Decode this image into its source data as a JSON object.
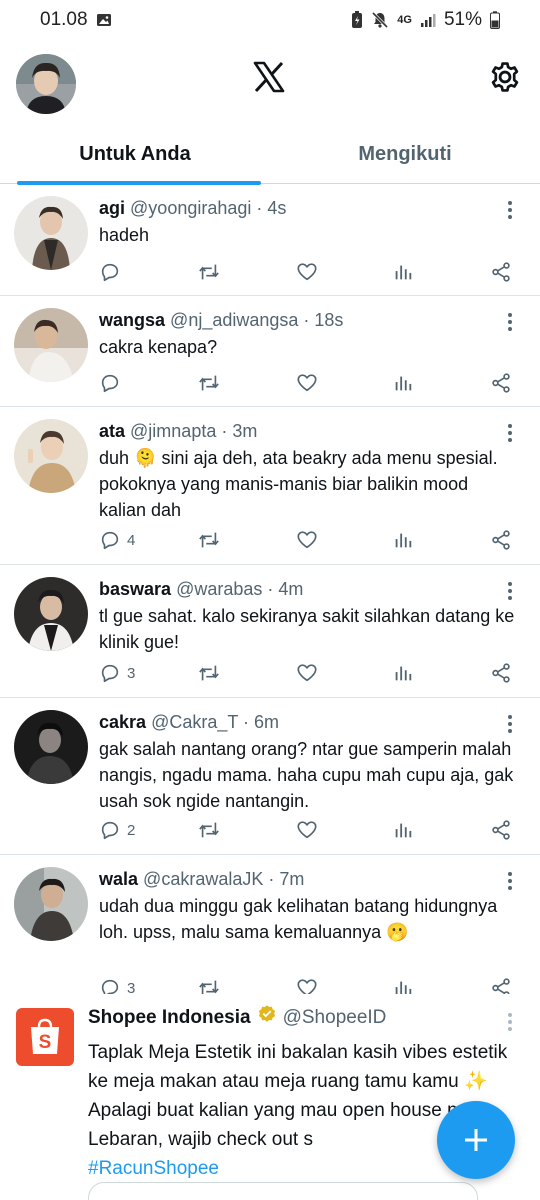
{
  "status": {
    "time": "01.08",
    "network": "4G",
    "battery": "51%"
  },
  "header": {
    "profile_icon": "avatar",
    "logo_icon": "x-logo-icon",
    "settings_icon": "gear-icon"
  },
  "tabs": [
    {
      "label": "Untuk Anda",
      "active": true
    },
    {
      "label": "Mengikuti",
      "active": false
    }
  ],
  "tweets": [
    {
      "name": "agi",
      "handle": "@yoongirahagi · 4s",
      "text": "hadeh",
      "replies": "",
      "avatar_color": "#6b5a4e"
    },
    {
      "name": "wangsa",
      "handle": "@nj_adiwangsa · 18s",
      "text": "cakra kenapa?",
      "replies": "",
      "avatar_color": "#8a7a6c"
    },
    {
      "name": "ata",
      "handle": "@jimnapta · 3m",
      "text": "duh 🫠 sini aja deh, ata beakry ada menu spesial. pokoknya yang manis-manis biar balikin mood kalian dah",
      "replies": "4",
      "avatar_color": "#c9a77a"
    },
    {
      "name": "baswara",
      "handle": "@warabas · 4m",
      "text": "tl gue sahat. kalo sekiranya sakit silahkan datang ke klinik gue!",
      "replies": "3",
      "avatar_color": "#3d3a3a"
    },
    {
      "name": "cakra",
      "handle": "@Cakra_T · 6m",
      "text": "gak salah nantang orang? ntar gue samperin malah nangis, ngadu mama. haha cupu mah cupu aja, gak usah sok ngide nantangin.",
      "replies": "2",
      "avatar_color": "#2a2a2a"
    },
    {
      "name": "wala",
      "handle": "@cakrawalaJK · 7m",
      "text": "udah dua minggu gak kelihatan batang hidungnya loh. upss, malu sama kemaluannya 🫢",
      "replies": "3",
      "avatar_color": "#3f3b38"
    }
  ],
  "promo": {
    "name": "Shopee Indonesia",
    "handle": "@ShopeeID",
    "text": "Taplak Meja Estetik ini bakalan kasih vibes estetik ke meja makan atau meja ruang tamu kamu ✨ Apalagi buat kalian yang mau open house pas Lebaran, wajib check out s",
    "hashtag": "#RacunShopee",
    "brand_color": "#ee4d2d"
  },
  "colors": {
    "accent": "#1d9bf0",
    "text": "#0f1419",
    "muted": "#536471"
  }
}
